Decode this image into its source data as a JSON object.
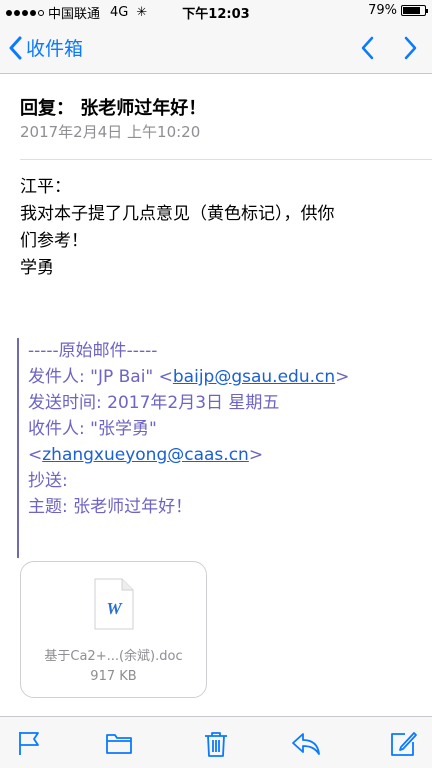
{
  "status_bar": {
    "carrier": "中国联通",
    "network": "4G",
    "time": "下午12:03",
    "battery": "79%",
    "battery_level": 0.79
  },
  "nav": {
    "back_label": "收件箱"
  },
  "message": {
    "subject": "回复： 张老师过年好！",
    "date": "2017年2月4日 上午10:20",
    "body": [
      "江平：",
      "我对本子提了几点意见（黄色标记），供你",
      "们参考！",
      "学勇"
    ]
  },
  "quote": {
    "separator": "-----原始邮件-----",
    "from_label": "发件人: \"JP Bai\" <",
    "from_email": "baijp@gsau.edu.cn",
    "from_end": ">",
    "sent": "发送时间: 2017年2月3日 星期五",
    "to_label": "收件人: \"张学勇\"",
    "to_open": "<",
    "to_email": "zhangxueyong@caas.cn",
    "to_end": ">",
    "cc": "抄送:",
    "subject": "主题: 张老师过年好！"
  },
  "attachment": {
    "name": "基于Ca2+...(余斌).doc",
    "size": "917 KB",
    "icon_letter": "W"
  },
  "colors": {
    "accent": "#0a7aff",
    "quote_text": "#6d64c6",
    "link": "#1a5fd6"
  }
}
